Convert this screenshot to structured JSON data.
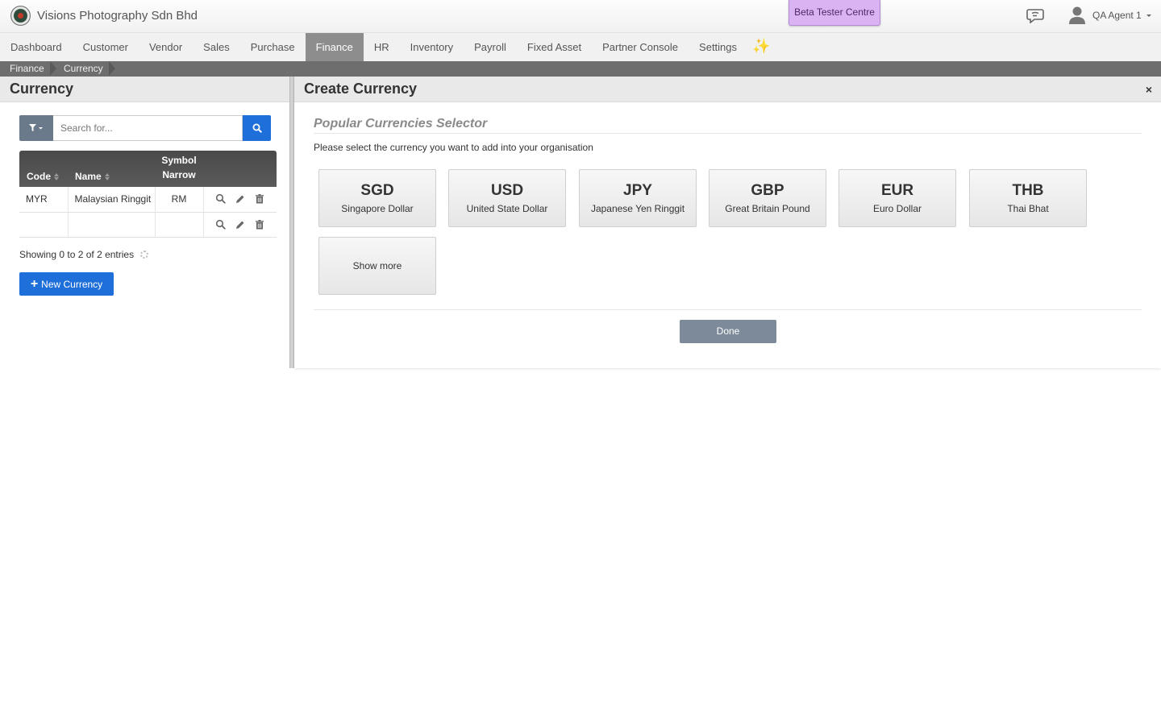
{
  "header": {
    "company": "Visions Photography Sdn Bhd",
    "beta_label": "Beta Tester Centre",
    "user_name": "QA Agent 1"
  },
  "nav": {
    "items": [
      "Dashboard",
      "Customer",
      "Vendor",
      "Sales",
      "Purchase",
      "Finance",
      "HR",
      "Inventory",
      "Payroll",
      "Fixed Asset",
      "Partner Console",
      "Settings"
    ],
    "active": "Finance",
    "sparkle": "✨"
  },
  "breadcrumb": [
    "Finance",
    "Currency"
  ],
  "left_panel": {
    "title": "Currency",
    "search_placeholder": "Search for...",
    "table": {
      "headers": [
        "Code",
        "Name",
        "Symbol Narrow"
      ],
      "symbol_header_line1": "Symbol",
      "symbol_header_line2": "Narrow",
      "rows": [
        {
          "code": "MYR",
          "name": "Malaysian Ringgit",
          "symbol": "RM"
        },
        {
          "code": "",
          "name": "",
          "symbol": ""
        }
      ]
    },
    "showing": "Showing 0 to 2 of 2 entries",
    "new_button": "New Currency"
  },
  "right_panel": {
    "title": "Create Currency",
    "close_symbol": "×",
    "selector_title": "Popular Currencies Selector",
    "instruction": "Please select the currency you want to add into your organisation",
    "currencies": [
      {
        "code": "SGD",
        "name": "Singapore Dollar"
      },
      {
        "code": "USD",
        "name": "United State Dollar"
      },
      {
        "code": "JPY",
        "name": "Japanese Yen Ringgit"
      },
      {
        "code": "GBP",
        "name": "Great Britain Pound"
      },
      {
        "code": "EUR",
        "name": "Euro Dollar"
      },
      {
        "code": "THB",
        "name": "Thai Bhat"
      }
    ],
    "show_more": "Show more",
    "done": "Done"
  },
  "colors": {
    "primary": "#1e6fd9",
    "nav_active": "#8d8d8d",
    "beta_bg": "#d9b3f2",
    "done_bg": "#7c8a99"
  }
}
